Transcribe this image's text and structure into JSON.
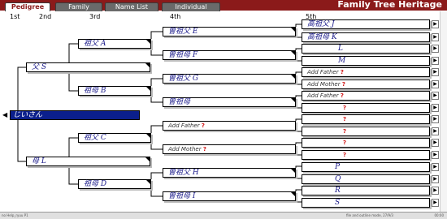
{
  "app": {
    "title": "Family Tree Heritage"
  },
  "tabs": [
    {
      "label": "Pedigree",
      "active": true
    },
    {
      "label": "Family",
      "active": false
    },
    {
      "label": "Name List",
      "active": false
    },
    {
      "label": "Individual",
      "active": false
    }
  ],
  "generations": [
    "1st",
    "2nd",
    "3rd",
    "4th",
    "5th"
  ],
  "root": {
    "name": "じいさん"
  },
  "gen2": [
    {
      "name": "父 S"
    },
    {
      "name": "母 L"
    }
  ],
  "gen3": [
    {
      "name": "祖父 A"
    },
    {
      "name": "祖母 B"
    },
    {
      "name": "祖父 C"
    },
    {
      "name": "祖母 D"
    }
  ],
  "gen4": [
    {
      "name": "曽祖父 E"
    },
    {
      "name": "曽祖母 F"
    },
    {
      "name": "曽祖父 G"
    },
    {
      "name": "曽祖母"
    },
    {
      "name": "Add Father",
      "q": "?"
    },
    {
      "name": "Add Mother",
      "q": "?"
    },
    {
      "name": "曽祖父 H"
    },
    {
      "name": "曽祖母 I"
    }
  ],
  "gen5": [
    {
      "name": "高祖父 J"
    },
    {
      "name": "高祖母 K"
    },
    {
      "name": "L"
    },
    {
      "name": "M"
    },
    {
      "name": "Add Father",
      "q": "?"
    },
    {
      "name": "Add Mother",
      "q": "?"
    },
    {
      "name": "Add Father",
      "q": "?"
    },
    {
      "name": "",
      "q": "?"
    },
    {
      "name": "",
      "q": "?"
    },
    {
      "name": "",
      "q": "?"
    },
    {
      "name": "",
      "q": "?"
    },
    {
      "name": "",
      "q": "?"
    },
    {
      "name": "P"
    },
    {
      "name": "Q"
    },
    {
      "name": "R"
    },
    {
      "name": "S"
    }
  ],
  "statusbar": {
    "left": "no Help_ryuu P1",
    "mid": "file and outline mode, 27/9/3",
    "right": "00:00"
  }
}
